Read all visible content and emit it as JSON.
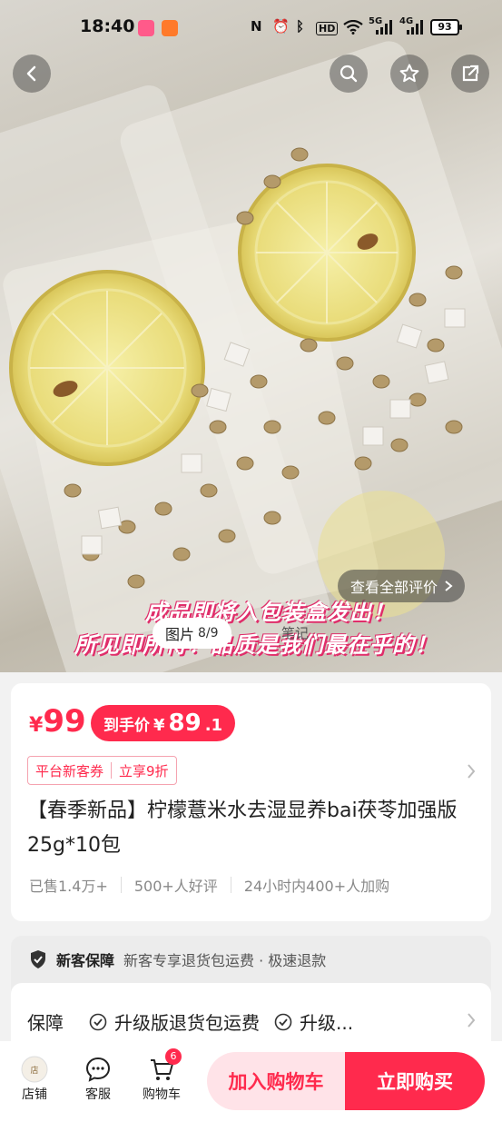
{
  "status_bar": {
    "time": "18:40",
    "battery": "93",
    "signal_label": "5G",
    "signal_label2": "4G"
  },
  "gallery": {
    "review_link": "查看全部评价",
    "image_tab_label": "图片",
    "image_index": "8/9",
    "notes_tab_label": "笔记",
    "overlay_line1": "成品即将入包装盒发出！",
    "overlay_line2": "所见即所得！品质是我们最在乎的！"
  },
  "price": {
    "currency": "¥",
    "value": "99",
    "final_label": "到手价",
    "final_currency": "¥",
    "final_int": "89",
    "final_dec": ".1"
  },
  "coupon": {
    "text1": "平台新客券",
    "text2": "立享9折"
  },
  "product_title": "【春季新品】柠檬薏米水去湿显养bai茯苓加强版25g*10包",
  "sales": {
    "sold": "已售1.4万+",
    "reviews": "500+人好评",
    "recent": "24小时内400+人加购"
  },
  "guarantee": {
    "new_title": "新客保障",
    "new_desc": "新客专享退货包运费 · 极速退款",
    "row_label": "保障",
    "item1": "升级版退货包运费",
    "item2": "升级..."
  },
  "bottom_bar": {
    "store": "店铺",
    "service": "客服",
    "cart": "购物车",
    "cart_badge": "6",
    "add_to_cart": "加入购物车",
    "buy_now": "立即购买"
  },
  "colors": {
    "accent": "#ff2a4d",
    "accent_light": "#ffe3e8"
  }
}
